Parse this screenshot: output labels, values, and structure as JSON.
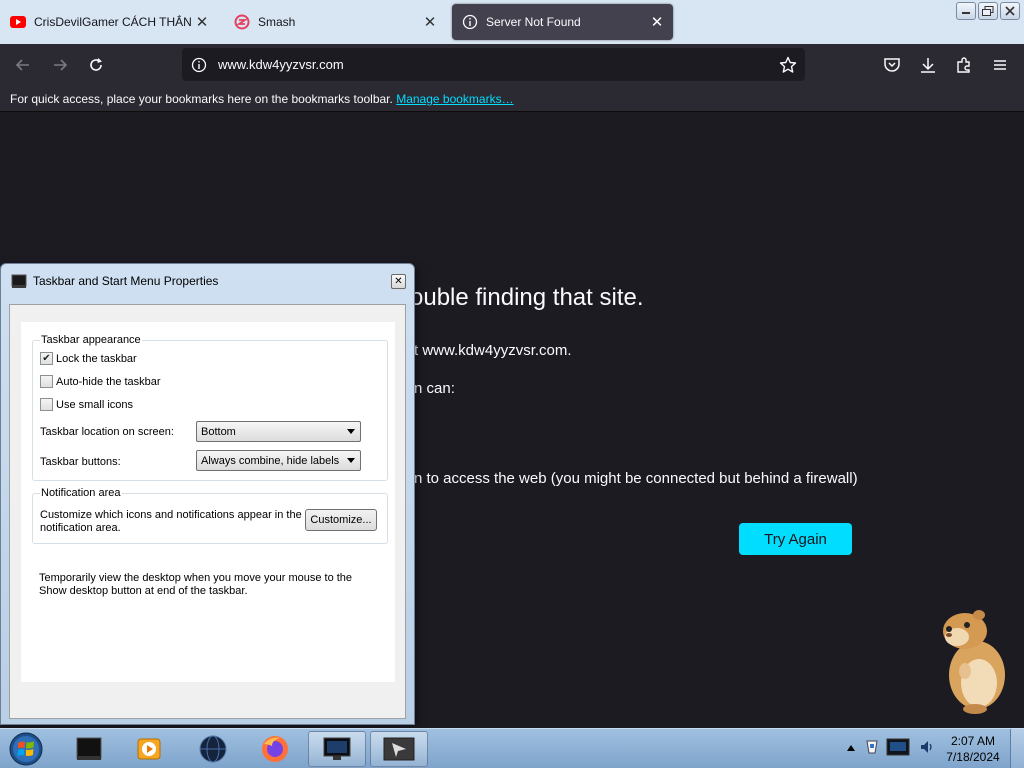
{
  "browser": {
    "tabs": [
      {
        "title": "CrisDevilGamer CÁCH THẮNG",
        "icon": "youtube-icon",
        "active": false
      },
      {
        "title": "Smash",
        "icon": "smash-icon",
        "active": false
      },
      {
        "title": "Server Not Found",
        "icon": "info-icon",
        "active": true
      }
    ],
    "tab_close_symbol": "✕",
    "url": "www.kdw4yyzvsr.com",
    "bookmarks_text": "For quick access, place your bookmarks here on the bookmarks toolbar.",
    "bookmarks_link": "Manage bookmarks…",
    "accent": "#00ddff"
  },
  "error_page": {
    "title_fragment": "ouble finding that site.",
    "line1": "t www.kdw4yyzvsr.com.",
    "line2": "n can:",
    "line3": "n to access the web (you might be connected but behind a firewall)",
    "try_again": "Try Again"
  },
  "dialog": {
    "title": "Taskbar and Start Menu Properties",
    "close_symbol": "✕",
    "appearance_group": "Taskbar appearance",
    "lock_taskbar": {
      "label": "Lock the taskbar",
      "checked": true
    },
    "auto_hide": {
      "label": "Auto-hide the taskbar",
      "checked": false
    },
    "small_icons": {
      "label": "Use small icons",
      "checked": false
    },
    "location_label": "Taskbar location on screen:",
    "location_value": "Bottom",
    "buttons_label": "Taskbar buttons:",
    "buttons_value": "Always combine, hide labels",
    "notification_group": "Notification area",
    "notification_text": "Customize which icons and notifications appear in the notification area.",
    "customize_button": "Customize...",
    "peek_text": "Temporarily view the desktop when you move your mouse to the Show desktop button at end of the taskbar."
  },
  "taskbar": {
    "time": "2:07 AM",
    "date": "7/18/2024",
    "items": [
      "window-icon",
      "media-player-icon",
      "globe-icon",
      "firefox-icon",
      "monitor-icon",
      "explorer-icon"
    ]
  }
}
